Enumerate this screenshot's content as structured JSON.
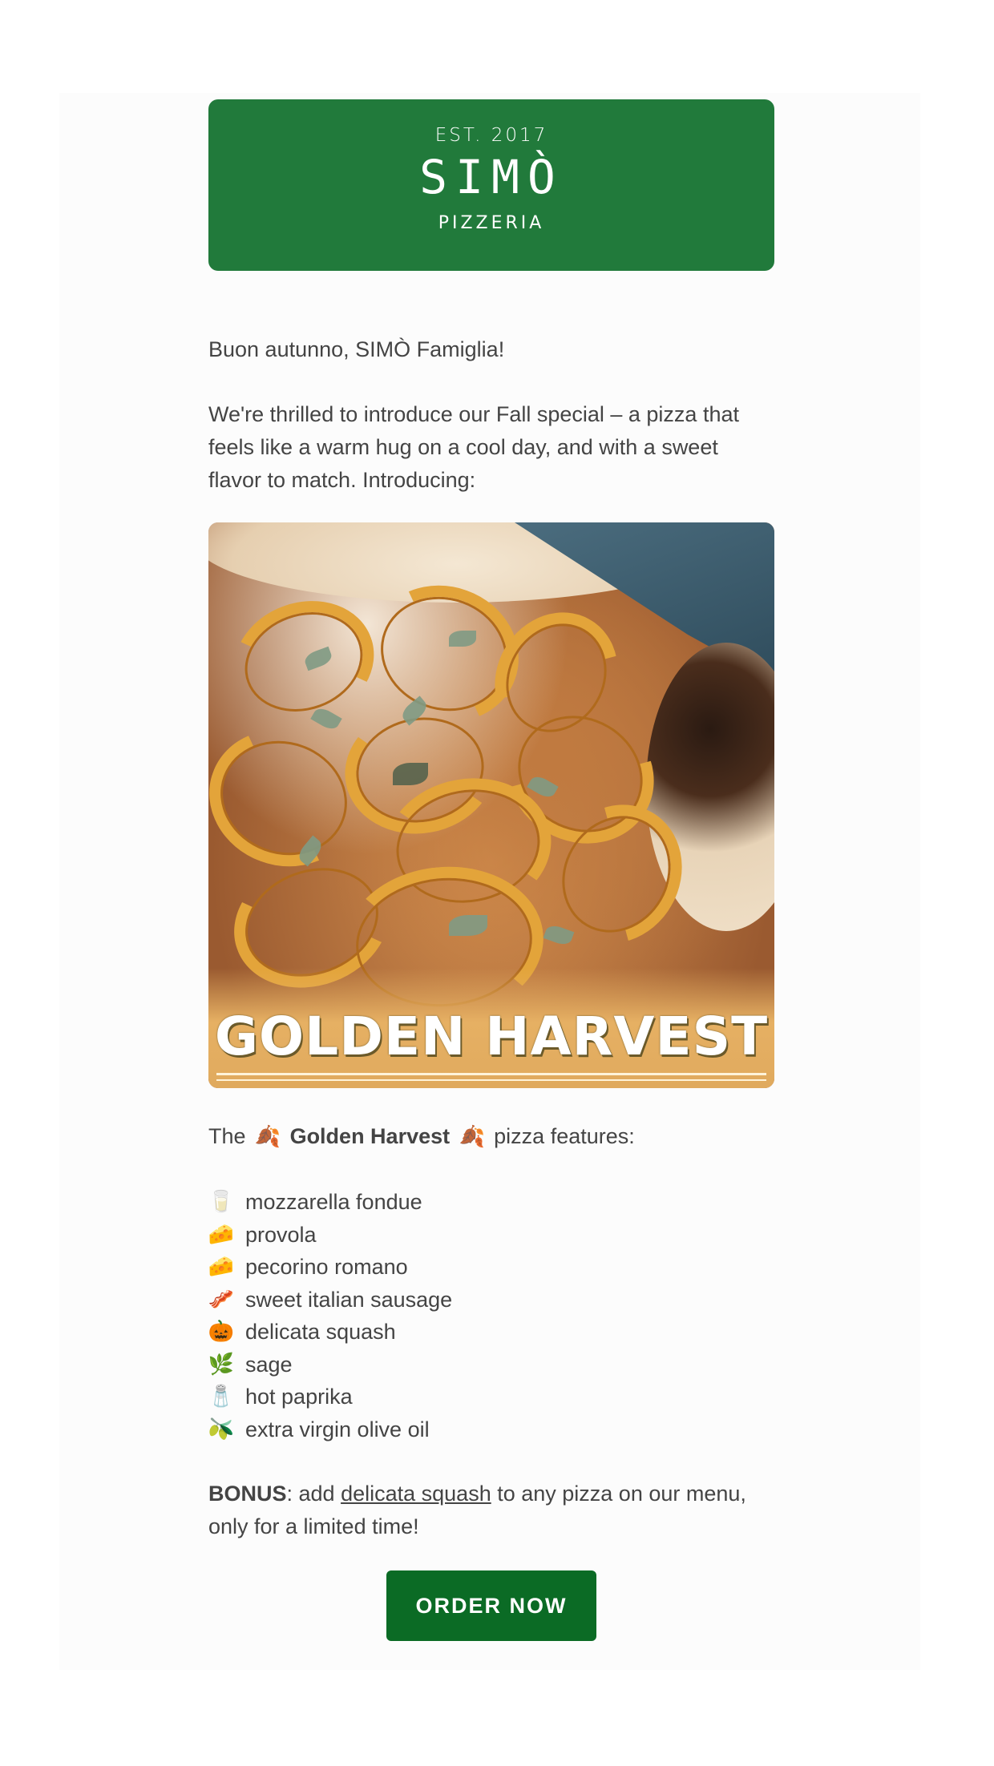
{
  "header": {
    "est": "EST. 2017",
    "brand": "SIMÒ",
    "sub": "PIZZERIA",
    "bg_color": "#217a3b"
  },
  "greeting": "Buon autunno, SIMÒ Famiglia!",
  "intro": "We're thrilled to introduce our Fall special – a pizza that feels like a warm hug on a cool day, and with a sweet flavor to match. Introducing:",
  "hero": {
    "title": "GOLDEN HARVEST",
    "image": "pizza-photo"
  },
  "features": {
    "prefix": "The",
    "name": "Golden Harvest",
    "suffix": "pizza features:",
    "icon": "fallen-leaves-icon"
  },
  "ingredients": [
    {
      "icon": "glass-of-milk-icon",
      "glyph": "🥛",
      "text": "mozzarella fondue"
    },
    {
      "icon": "cheese-icon",
      "glyph": "🧀",
      "text": "provola"
    },
    {
      "icon": "cheese-icon",
      "glyph": "🧀",
      "text": "pecorino romano"
    },
    {
      "icon": "bacon-icon",
      "glyph": "🥓",
      "text": "sweet italian sausage"
    },
    {
      "icon": "pumpkin-icon",
      "glyph": "🎃",
      "text": "delicata squash"
    },
    {
      "icon": "herb-leaf-icon",
      "glyph": "🌿",
      "text": "sage"
    },
    {
      "icon": "salt-shaker-icon",
      "glyph": "🧂",
      "text": "hot paprika"
    },
    {
      "icon": "olive-icon",
      "glyph": "🫒",
      "text": "extra virgin olive oil"
    }
  ],
  "bonus": {
    "label": "BONUS",
    "pre": ": add ",
    "link": "delicata squash",
    "post": " to any pizza on our menu, only for a limited time!"
  },
  "cta": {
    "label": "ORDER NOW",
    "color": "#0b6b25"
  }
}
